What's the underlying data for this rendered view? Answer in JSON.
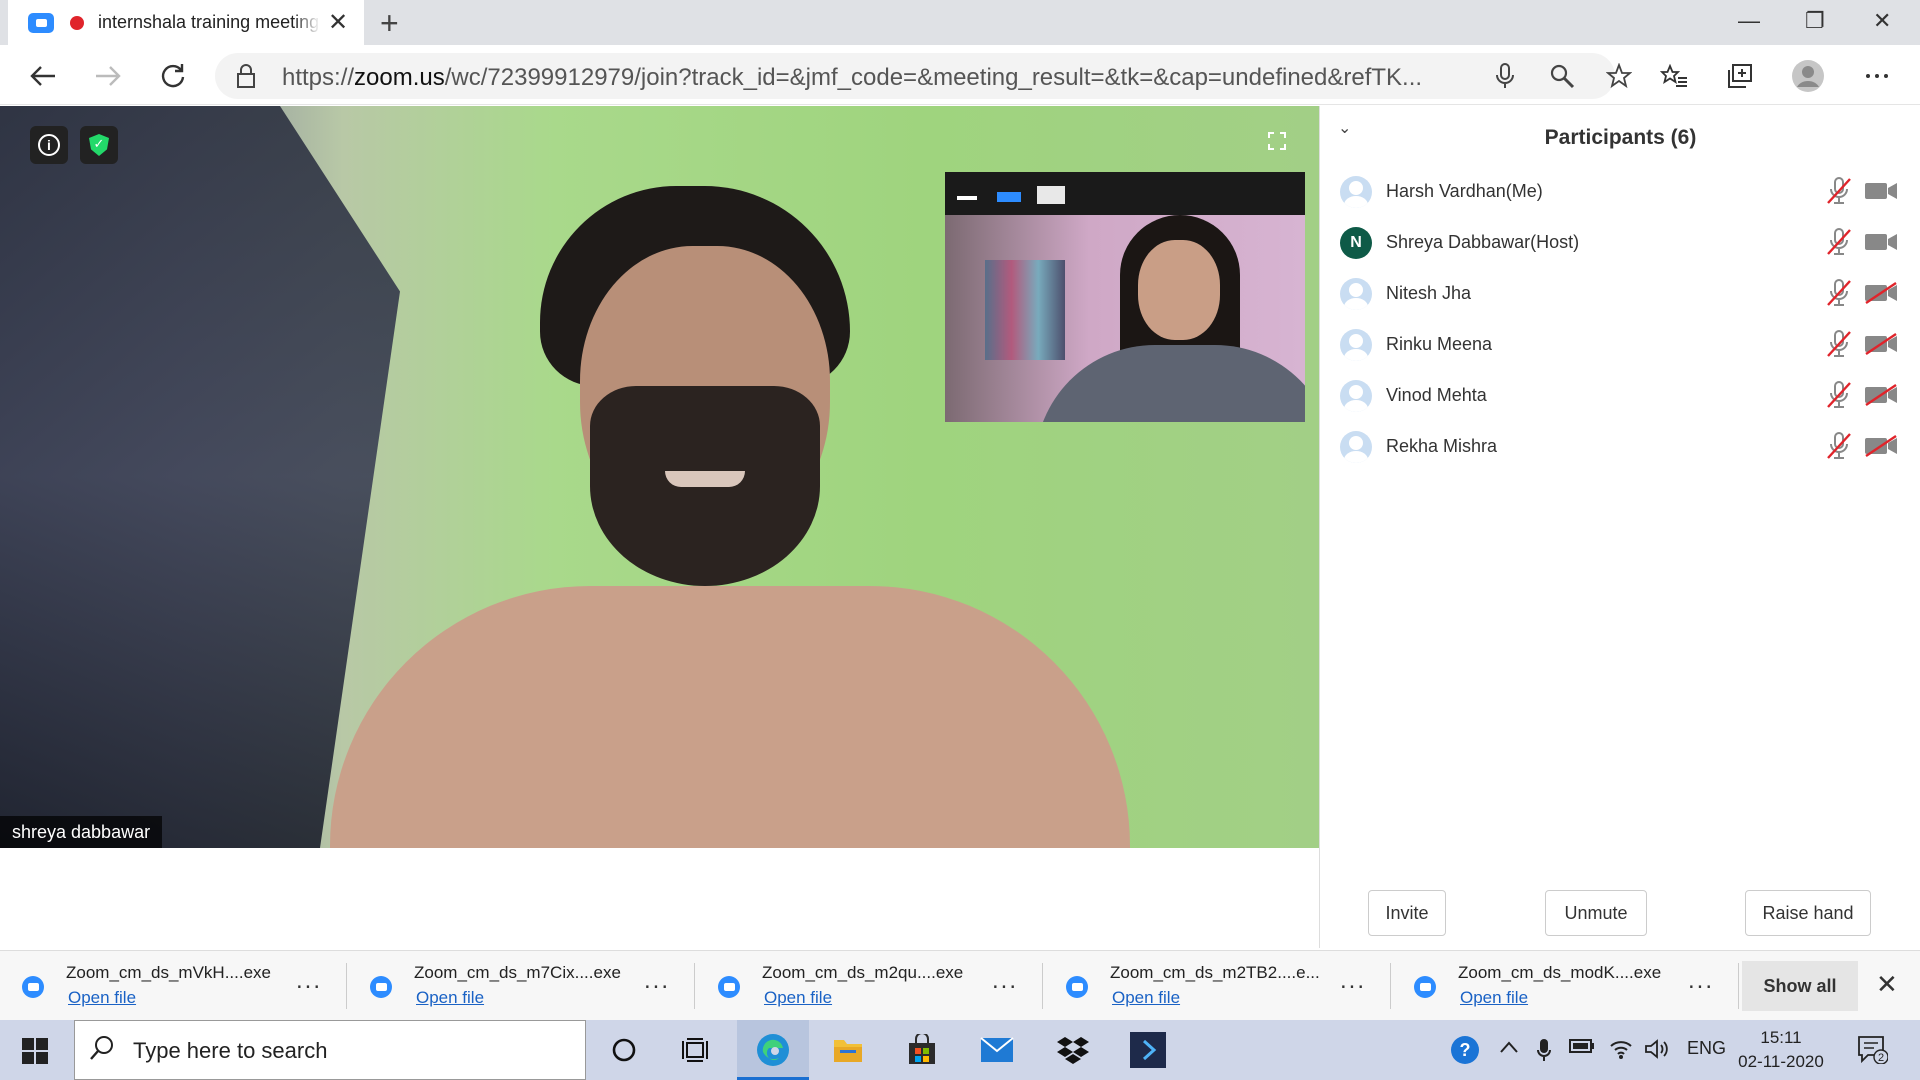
{
  "browser": {
    "tab_title": "internshala training meeting",
    "tab_close": "✕",
    "new_tab": "+",
    "url_prefix": "https://",
    "url_domain": "zoom.us",
    "url_rest": "/wc/72399912979/join?track_id=&jmf_code=&meeting_result=&tk=&cap=undefined&refTK...",
    "window_controls": [
      "—",
      "❐",
      "✕"
    ]
  },
  "video": {
    "main_speaker_name": "shreya dabbawar",
    "info_icon": "i",
    "shield_icon": "✓",
    "fullscreen_icon": "⤢"
  },
  "participants": {
    "title": "Participants (6)",
    "collapse_icon": "⌄",
    "list": [
      {
        "name": "Harsh Vardhan(Me)",
        "avatar": "",
        "video_on": true
      },
      {
        "name": "Shreya Dabbawar(Host)",
        "avatar": "N",
        "video_on": true
      },
      {
        "name": "Nitesh Jha",
        "avatar": "",
        "video_on": false
      },
      {
        "name": "Rinku Meena",
        "avatar": "",
        "video_on": false
      },
      {
        "name": "Vinod Mehta",
        "avatar": "",
        "video_on": false
      },
      {
        "name": "Rekha Mishra",
        "avatar": "",
        "video_on": false
      }
    ],
    "buttons": {
      "invite": "Invite",
      "unmute": "Unmute",
      "raise_hand": "Raise hand"
    }
  },
  "downloads": {
    "items": [
      {
        "file": "Zoom_cm_ds_mVkH....exe",
        "action": "Open file"
      },
      {
        "file": "Zoom_cm_ds_m7Cix....exe",
        "action": "Open file"
      },
      {
        "file": "Zoom_cm_ds_m2qu....exe",
        "action": "Open file"
      },
      {
        "file": "Zoom_cm_ds_m2TB2....e...",
        "action": "Open file"
      },
      {
        "file": "Zoom_cm_ds_modK....exe",
        "action": "Open file"
      }
    ],
    "more": "...",
    "show_all": "Show all",
    "close": "✕"
  },
  "taskbar": {
    "search_placeholder": "Type here to search",
    "language": "ENG",
    "time": "15:11",
    "date": "02-11-2020",
    "notification_count": "2"
  },
  "colors": {
    "zoom_blue": "#2d8cff",
    "muted_red": "#e0242b",
    "host_avatar": "#0e5a47"
  }
}
